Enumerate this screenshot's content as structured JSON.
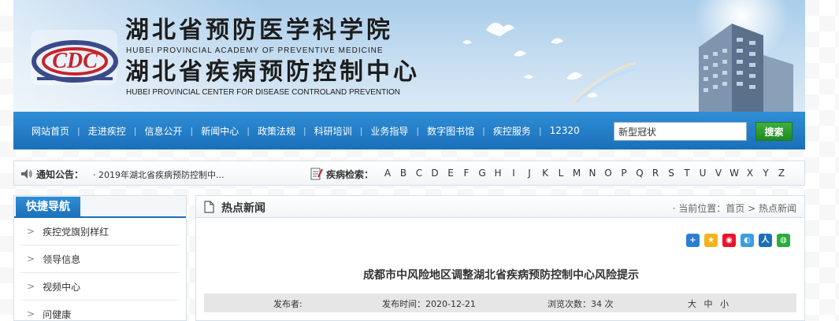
{
  "header": {
    "title_cn_1": "湖北省预防医学科学院",
    "title_en_1": "HUBEI PROVINCIAL ACADEMY OF PREVENTIVE MEDICINE",
    "title_cn_2": "湖北省疾病预防控制中心",
    "title_en_2": "HUBEI PROVINCIAL CENTER FOR DISEASE CONTROLAND PREVENTION",
    "logo_text": "CDC"
  },
  "nav": {
    "items": [
      "网站首页",
      "走进疾控",
      "信息公开",
      "新闻中心",
      "政策法规",
      "科研培训",
      "业务指导",
      "数字图书馆",
      "疾控服务",
      "12320"
    ],
    "separator": "|",
    "search_value": "新型冠状",
    "search_button": "搜索"
  },
  "notice": {
    "label": "通知公告：",
    "text": "· 2019年湖北省疾病预防控制中...",
    "disease_label": "疾病检索：",
    "letters": [
      "A",
      "B",
      "C",
      "D",
      "E",
      "F",
      "G",
      "H",
      "I",
      "J",
      "K",
      "L",
      "M",
      "N",
      "O",
      "P",
      "Q",
      "R",
      "S",
      "T",
      "U",
      "V",
      "W",
      "X",
      "Y",
      "Z"
    ]
  },
  "sidebar": {
    "title": "快捷导航",
    "arrow": ">",
    "items": [
      "疾控党旗别样红",
      "领导信息",
      "视频中心",
      "问健康"
    ]
  },
  "main": {
    "section_title": "热点新闻",
    "breadcrumb": {
      "prefix": "· 当前位置：",
      "home": "首页",
      "sep": ">",
      "current": "热点新闻"
    },
    "share_icons": [
      "plus-share",
      "qzone",
      "weibo",
      "tencent-weibo",
      "renren",
      "wechat"
    ],
    "article_title": "成都市中风险地区调整湖北省疾病预防控制中心风险提示",
    "publisher_label": "发布者:",
    "date_label": "发布时间：2020-12-21",
    "views_label": "浏览次数：34 次",
    "font_sizes": [
      "大",
      "中",
      "小"
    ]
  },
  "colors": {
    "nav_blue": "#1b6fb9",
    "search_green": "#208a21",
    "meta_gray": "#e6e6e6"
  }
}
